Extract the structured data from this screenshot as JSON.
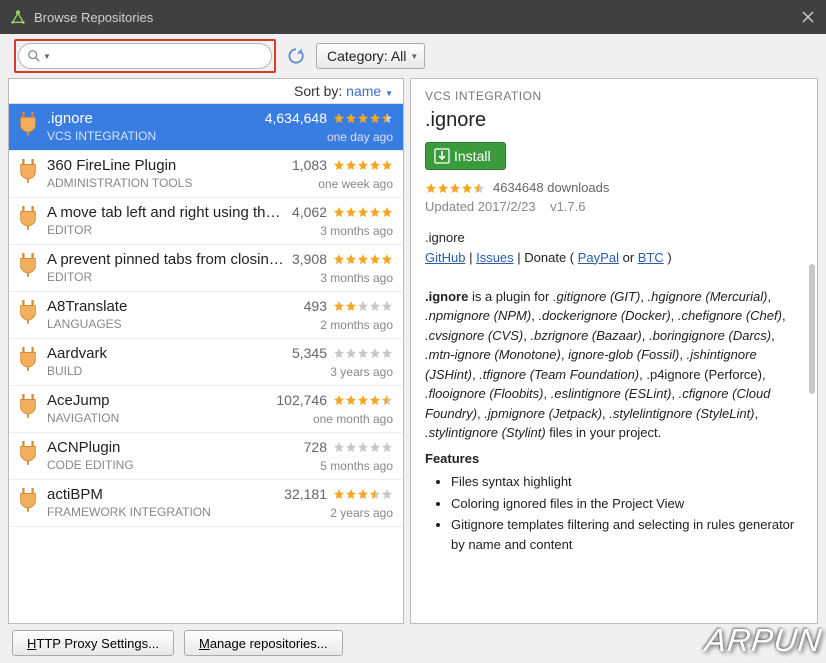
{
  "window": {
    "title": "Browse Repositories"
  },
  "toolbar": {
    "search_value": "",
    "category_label": "Category: All"
  },
  "sort": {
    "label": "Sort by:",
    "value": "name"
  },
  "colors": {
    "selected": "#3a7de0",
    "star_gold": "#f5a623",
    "star_grey": "#c8c8c8"
  },
  "plugins": [
    {
      "name": ".ignore",
      "category": "VCS INTEGRATION",
      "downloads": "4,634,648",
      "rating": 4.5,
      "updated": "one day ago",
      "selected": true
    },
    {
      "name": "360 FireLine Plugin",
      "category": "ADMINISTRATION TOOLS",
      "downloads": "1,083",
      "rating": 5,
      "updated": "one week ago"
    },
    {
      "name": "A move tab left and right using the keyboard plugin",
      "category": "EDITOR",
      "downloads": "4,062",
      "rating": 5,
      "updated": "3 months ago"
    },
    {
      "name": "A prevent pinned tabs from closing plugin",
      "category": "EDITOR",
      "downloads": "3,908",
      "rating": 5,
      "updated": "3 months ago"
    },
    {
      "name": "A8Translate",
      "category": "LANGUAGES",
      "downloads": "493",
      "rating": 2,
      "updated": "2 months ago"
    },
    {
      "name": "Aardvark",
      "category": "BUILD",
      "downloads": "5,345",
      "rating": 0,
      "updated": "3 years ago"
    },
    {
      "name": "AceJump",
      "category": "NAVIGATION",
      "downloads": "102,746",
      "rating": 4.5,
      "updated": "one month ago"
    },
    {
      "name": "ACNPlugin",
      "category": "CODE EDITING",
      "downloads": "728",
      "rating": 0,
      "updated": "5 months ago"
    },
    {
      "name": "actiBPM",
      "category": "FRAMEWORK INTEGRATION",
      "downloads": "32,181",
      "rating": 3.5,
      "updated": "2 years ago"
    }
  ],
  "detail": {
    "category": "VCS INTEGRATION",
    "name": ".ignore",
    "install_label": "Install",
    "rating": 4.5,
    "downloads_text": "4634648 downloads",
    "updated_label": "Updated",
    "updated_date": "2017/2/23",
    "version": "v1.7.6",
    "body_name": ".ignore",
    "links": {
      "github": "GitHub",
      "issues": "Issues",
      "donate_prefix": "Donate (",
      "paypal": "PayPal",
      "or": "or",
      "btc": "BTC",
      "donate_suffix": ")"
    },
    "description": ".ignore is a plugin for .gitignore (GIT), .hgignore (Mercurial), .npmignore (NPM), .dockerignore (Docker), .chefignore (Chef), .cvsignore (CVS), .bzrignore (Bazaar), .boringignore (Darcs), .mtn-ignore (Monotone), ignore-glob (Fossil), .jshintignore (JSHint), .tfignore (Team Foundation), .p4ignore (Perforce), .flooignore (Floobits), .eslintignore (ESLint), .cfignore (Cloud Foundry), .jpmignore (Jetpack), .stylelintignore (StyleLint), .stylintignore (Stylint) files in your project.",
    "features_label": "Features",
    "features": [
      "Files syntax highlight",
      "Coloring ignored files in the Project View",
      "Gitignore templates filtering and selecting in rules generator by name and content"
    ]
  },
  "footer": {
    "proxy": "HTTP Proxy Settings...",
    "proxy_u": "H",
    "manage": "Manage repositories...",
    "manage_u": "M"
  },
  "watermark": "ARPUN"
}
